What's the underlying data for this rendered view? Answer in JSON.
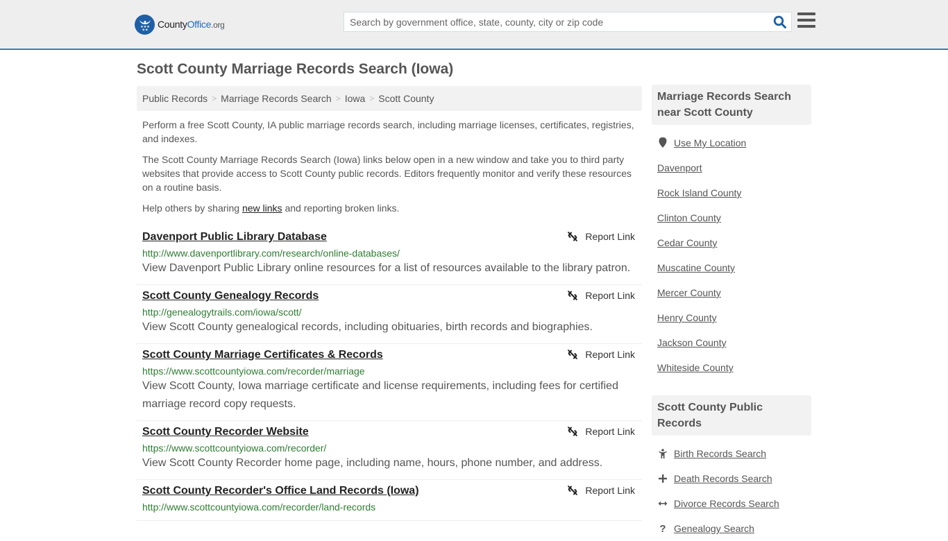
{
  "header": {
    "logo": {
      "part1": "County",
      "part2": "Office",
      "part3": ".org"
    },
    "search": {
      "placeholder": "Search by government office, state, county, city or zip code",
      "value": ""
    },
    "colors": {
      "accent": "#357eb6",
      "brand": "#1f5fa6",
      "background": "#eeeeee"
    }
  },
  "page": {
    "title": "Scott County Marriage Records Search (Iowa)"
  },
  "breadcrumb": [
    {
      "label": "Public Records"
    },
    {
      "label": "Marriage Records Search"
    },
    {
      "label": "Iowa"
    },
    {
      "label": "Scott County"
    }
  ],
  "breadcrumb_separator": ">",
  "intro": {
    "p1": "Perform a free Scott County, IA public marriage records search, including marriage licenses, certificates, registries, and indexes.",
    "p2": "The Scott County Marriage Records Search (Iowa) links below open in a new window and take you to third party websites that provide access to Scott County public records. Editors frequently monitor and verify these resources on a routine basis.",
    "p3_before": "Help others by sharing ",
    "p3_link": "new links",
    "p3_after": " and reporting broken links."
  },
  "results": [
    {
      "title": "Davenport Public Library Database",
      "url": "http://www.davenportlibrary.com/research/online-databases/",
      "description": "View Davenport Public Library online resources for a list of resources available to the library patron.",
      "report_label": "Report Link"
    },
    {
      "title": "Scott County Genealogy Records",
      "url": "http://genealogytrails.com/iowa/scott/",
      "description": "View Scott County genealogical records, including obituaries, birth records and biographies.",
      "report_label": "Report Link"
    },
    {
      "title": "Scott County Marriage Certificates & Records",
      "url": "https://www.scottcountyiowa.com/recorder/marriage",
      "description": "View Scott County, Iowa marriage certificate and license requirements, including fees for certified marriage record copy requests.",
      "report_label": "Report Link"
    },
    {
      "title": "Scott County Recorder Website",
      "url": "https://www.scottcountyiowa.com/recorder/",
      "description": "View Scott County Recorder home page, including name, hours, phone number, and address.",
      "report_label": "Report Link"
    },
    {
      "title": "Scott County Recorder's Office Land Records (Iowa)",
      "url": "http://www.scottcountyiowa.com/recorder/land-records",
      "description": "",
      "report_label": "Report Link"
    }
  ],
  "sidebar": {
    "nearby": {
      "heading": "Marriage Records Search near Scott County",
      "use_location": {
        "label": "Use My Location",
        "icon": "map-marker-icon"
      },
      "items": [
        {
          "label": "Davenport"
        },
        {
          "label": "Rock Island County"
        },
        {
          "label": "Clinton County"
        },
        {
          "label": "Cedar County"
        },
        {
          "label": "Muscatine County"
        },
        {
          "label": "Mercer County"
        },
        {
          "label": "Henry County"
        },
        {
          "label": "Jackson County"
        },
        {
          "label": "Whiteside County"
        }
      ]
    },
    "public_records": {
      "heading": "Scott County Public Records",
      "items": [
        {
          "label": "Birth Records Search",
          "icon": "child-icon"
        },
        {
          "label": "Death Records Search",
          "icon": "plus-icon"
        },
        {
          "label": "Divorce Records Search",
          "icon": "arrows-horizontal-icon"
        },
        {
          "label": "Genealogy Search",
          "icon": "question-icon"
        }
      ]
    }
  }
}
